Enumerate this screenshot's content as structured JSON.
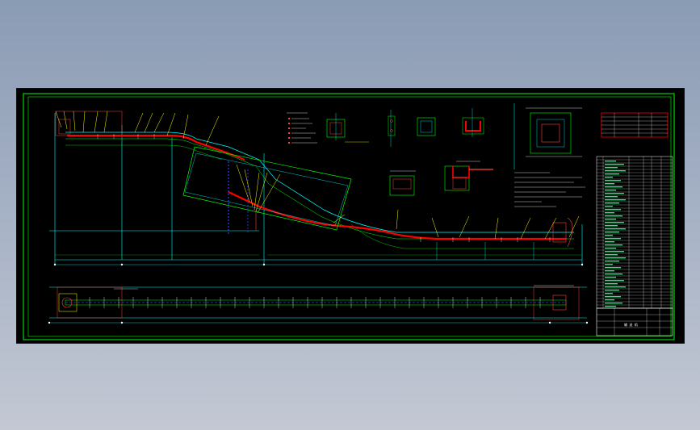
{
  "viewer": {
    "background_top": "#8a9bb4",
    "background_bottom": "#c3c8d3"
  },
  "drawing": {
    "sheet_color": "#000000",
    "frame_color": "#00ff00",
    "conveyor_color": "#ff0000",
    "structure_color": "#00ffff",
    "section_color": "#ffff00",
    "leader_color": "#ffff00",
    "text_color": "#ffffff",
    "title_block_label": "输 送 机"
  }
}
